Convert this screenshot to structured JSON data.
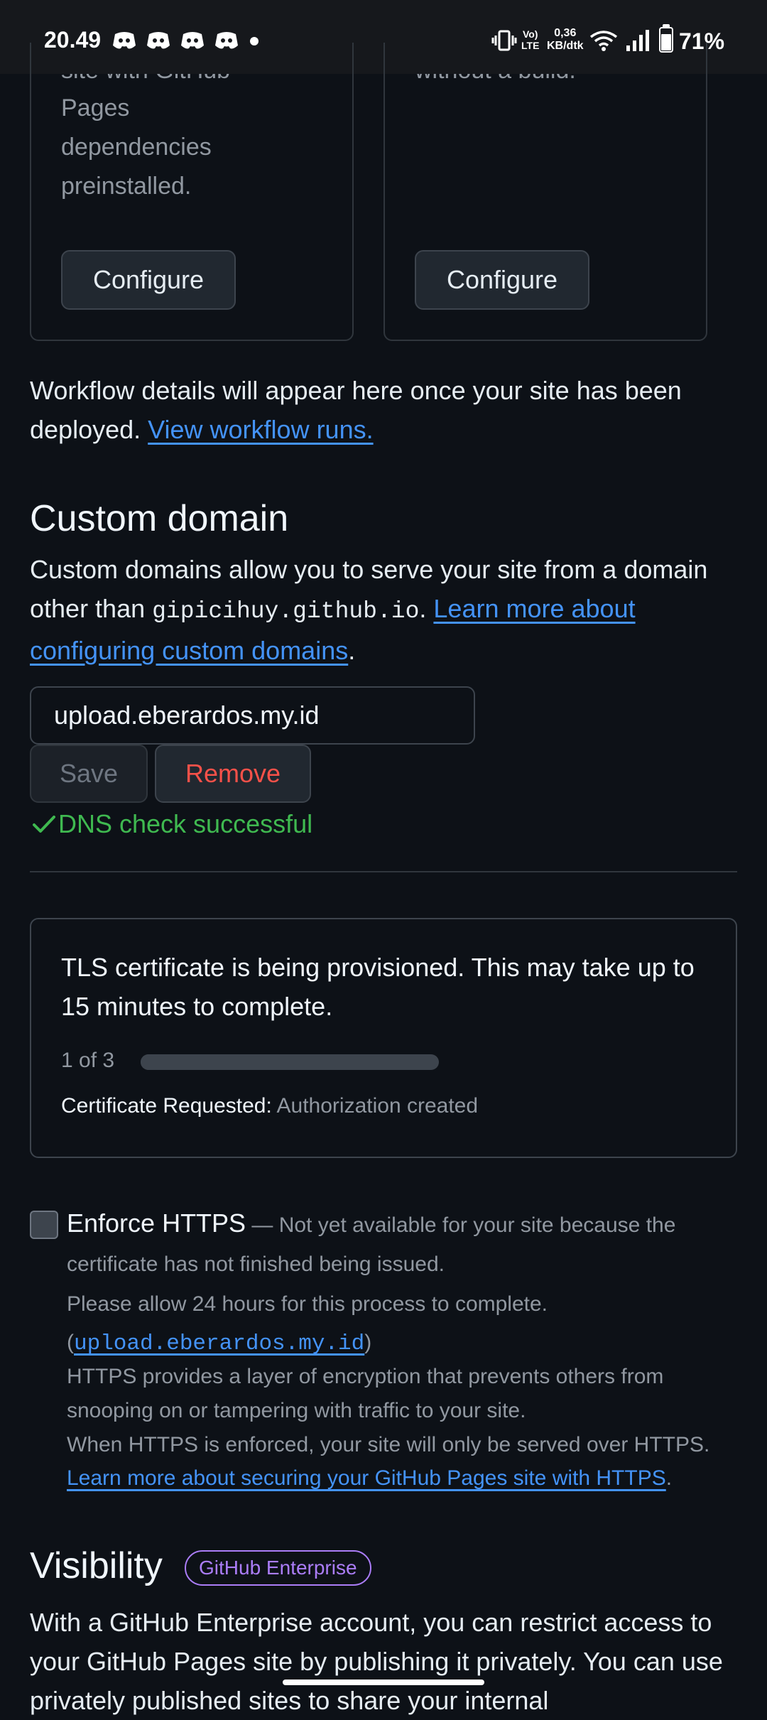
{
  "status_bar": {
    "time": "20.49",
    "volte_top": "Vo)",
    "volte_bottom": "LTE",
    "speed_top": "0,36",
    "speed_bottom": "KB/dtk",
    "battery": "71%",
    "battery_level": 0.71
  },
  "cards": {
    "left_text_partial": "site with GitHub",
    "left_text_lines": [
      "Pages",
      "dependencies",
      "preinstalled."
    ],
    "right_text_partial": "without a build.",
    "configure_label": "Configure"
  },
  "workflow": {
    "text": "Workflow details will appear here once your site has been deployed.",
    "link": "View workflow runs."
  },
  "custom_domain": {
    "title": "Custom domain",
    "desc_line1": "Custom domains allow you to serve your site from a domain",
    "desc_prefix": "other than ",
    "domain_code": "gipicihuy.github.io",
    "desc_suffix": ". ",
    "learn_link_line1": "Learn more about",
    "learn_link_line2": "configuring custom domains",
    "period": ".",
    "input_value": "upload.eberardos.my.id",
    "save_label": "Save",
    "remove_label": "Remove",
    "dns_status": "DNS check successful"
  },
  "tls": {
    "message": "TLS certificate is being provisioned. This may take up to 15 minutes to complete.",
    "step": "1 of 3",
    "progress": 0.33,
    "requested_label": "Certificate Requested:",
    "requested_value": "Authorization created"
  },
  "https": {
    "label": "Enforce HTTPS",
    "dash_note": " — Not yet available for your site because the certificate has not finished being issued.",
    "allow_note": "Please allow 24 hours for this process to complete.",
    "paren_open": "(",
    "domain_link": "upload.eberardos.my.id",
    "paren_close": ")",
    "desc1": "HTTPS provides a layer of encryption that prevents others from snooping on or tampering with traffic to your site.",
    "desc2": "When HTTPS is enforced, your site will only be served over HTTPS.",
    "learn_link": "Learn more about securing your GitHub Pages site with HTTPS",
    "period": "."
  },
  "visibility": {
    "title": "Visibility",
    "badge": "GitHub Enterprise",
    "desc": "With a GitHub Enterprise account, you can restrict access to your GitHub Pages site by publishing it privately. You can use privately published sites to share your internal"
  },
  "colors": {
    "background": "#0d1117",
    "link": "#4493f8",
    "success": "#3fb950",
    "danger": "#f85149",
    "badge": "#ab7df8"
  }
}
